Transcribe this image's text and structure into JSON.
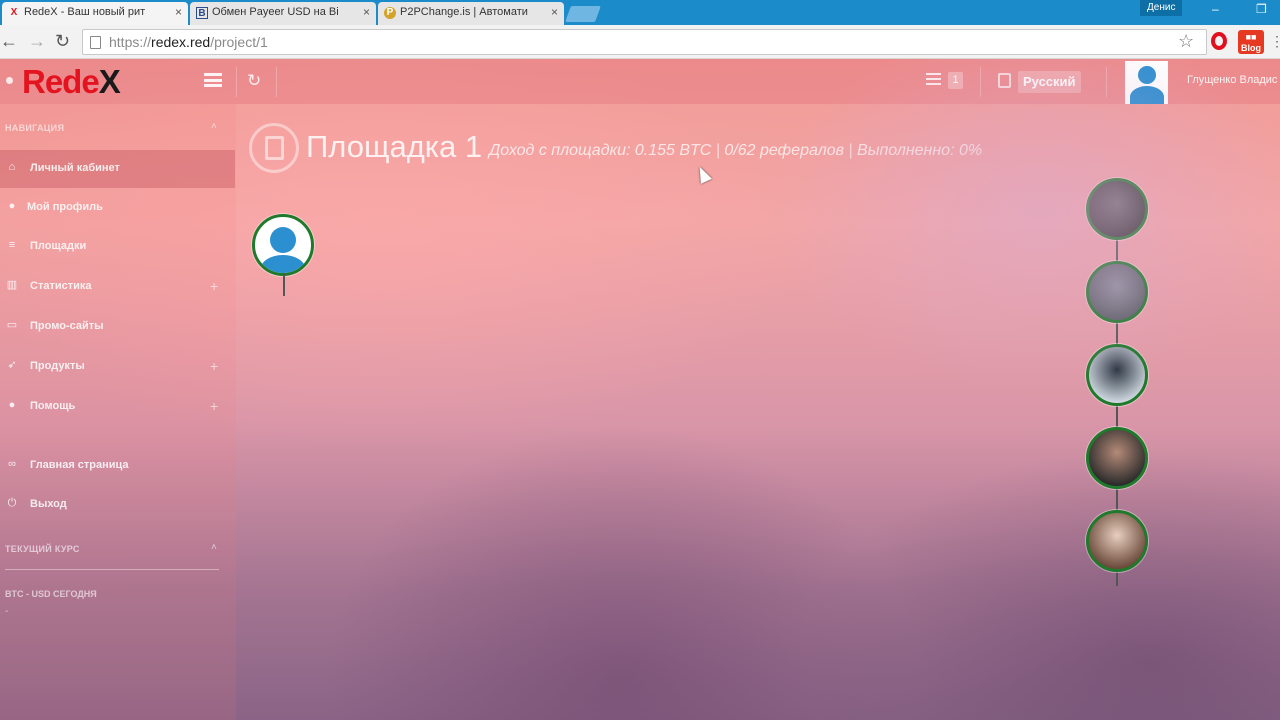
{
  "browser": {
    "tabs": [
      {
        "label": "RedeX - Ваш новый рит",
        "favicon": "X"
      },
      {
        "label": "Обмен Payeer USD на Bi",
        "favicon": "B"
      },
      {
        "label": "P2PChange.is | Автомати",
        "favicon": "P"
      }
    ],
    "window_user": "Денис",
    "url": {
      "scheme": "https://",
      "host": "redex.red",
      "path": "/project/1"
    },
    "blog_ext_label": "Blog"
  },
  "app": {
    "logo": {
      "main": "Rede",
      "accent": "X"
    },
    "header": {
      "messages_count": "1",
      "language": "Русский",
      "user_name": "Глущенко Владис"
    },
    "sidebar": {
      "nav_heading": "НАВИГАЦИЯ",
      "items": [
        {
          "label": "Личный кабинет",
          "icon": "home-icon",
          "expandable": false
        },
        {
          "label": "Мой профиль",
          "icon": "user-icon",
          "expandable": false
        },
        {
          "label": "Площадки",
          "icon": "list-icon",
          "expandable": false
        },
        {
          "label": "Статистика",
          "icon": "chart-icon",
          "expandable": true
        },
        {
          "label": "Промо-сайты",
          "icon": "monitor-icon",
          "expandable": false
        },
        {
          "label": "Продукты",
          "icon": "rocket-icon",
          "expandable": true
        },
        {
          "label": "Помощь",
          "icon": "help-icon",
          "expandable": true
        },
        {
          "label": "Главная страница",
          "icon": "link-icon",
          "expandable": false
        },
        {
          "label": "Выход",
          "icon": "power-icon",
          "expandable": false
        }
      ],
      "rate_heading": "ТЕКУЩИЙ КУРС",
      "rate_label": "BTC - USD СЕГОДНЯ",
      "rate_value": "-"
    },
    "main": {
      "title": "Площадка 1",
      "income": "Доход с площадки: 0.155 BTC",
      "referrals": "0/62 рефералов",
      "completed": "Выполненно: 0%",
      "separator": "|"
    },
    "referral_nodes": [
      {
        "kind": "photo",
        "colors": [
          "#3a3a3a",
          "#6b6b6b"
        ]
      },
      {
        "kind": "photo",
        "colors": [
          "#5a5f66",
          "#8a8f99"
        ]
      },
      {
        "kind": "photo",
        "colors": [
          "#cfd8e0",
          "#2a3540"
        ]
      },
      {
        "kind": "photo",
        "colors": [
          "#2b2b2b",
          "#b58a78"
        ]
      },
      {
        "kind": "photo",
        "colors": [
          "#6b4a3a",
          "#e8cfc0"
        ]
      }
    ],
    "colors": {
      "brand_red": "#e3141f",
      "node_border": "#1f7a2b",
      "avatar_blue": "#2b8fd0"
    }
  }
}
